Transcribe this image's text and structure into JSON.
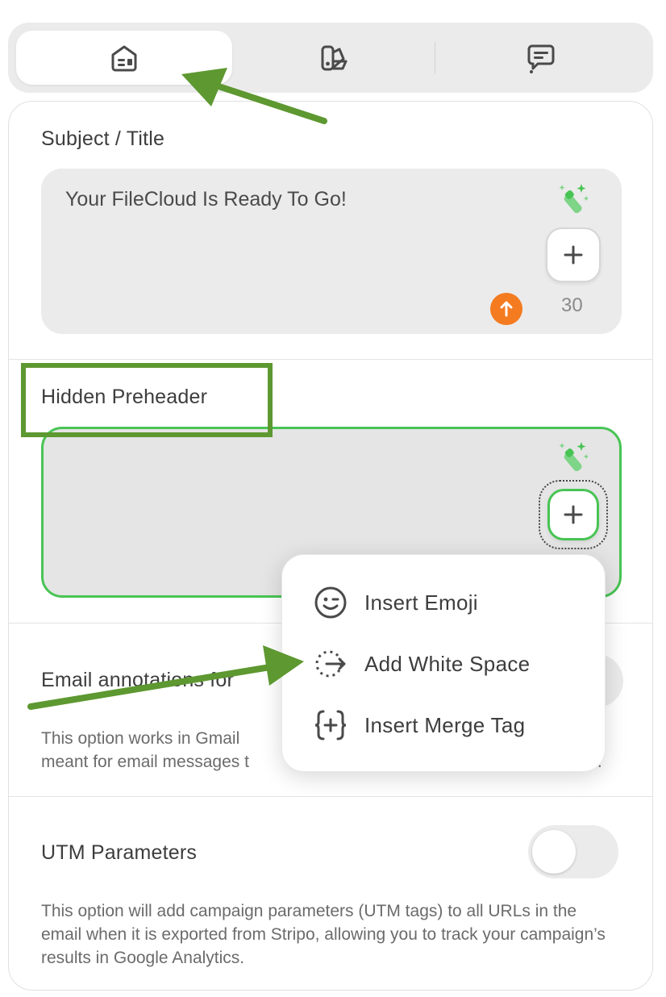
{
  "tabs": [
    {
      "icon": "email-settings-icon",
      "active": true
    },
    {
      "icon": "color-palette-icon",
      "active": false
    },
    {
      "icon": "comments-icon",
      "active": false
    }
  ],
  "subject": {
    "label": "Subject / Title",
    "value": "Your FileCloud Is Ready To Go!",
    "counter": "30"
  },
  "preheader": {
    "label": "Hidden Preheader",
    "value": ""
  },
  "annotations": {
    "label": "Email annotations for",
    "description": "This option works in Gmail                                                                             meant for email messages t"
  },
  "annotations_desc_line1": "This option works in Gmail",
  "annotations_desc_line2": "meant for email messages t",
  "annotations_desc_tail": "r.",
  "utm": {
    "label": "UTM Parameters",
    "enabled": false,
    "description": "This option will add campaign parameters (UTM tags) to all URLs in the email when it is exported from Stripo, allowing you to track your campaign’s results in Google Analytics."
  },
  "menu": {
    "items": [
      {
        "label": "Insert Emoji",
        "icon": "emoji-icon"
      },
      {
        "label": "Add White Space",
        "icon": "white-space-icon"
      },
      {
        "label": "Insert Merge Tag",
        "icon": "merge-tag-icon"
      }
    ]
  },
  "colors": {
    "accent_green": "#48c454",
    "annotation_green": "#5d9830",
    "warning_orange": "#f47b20"
  }
}
